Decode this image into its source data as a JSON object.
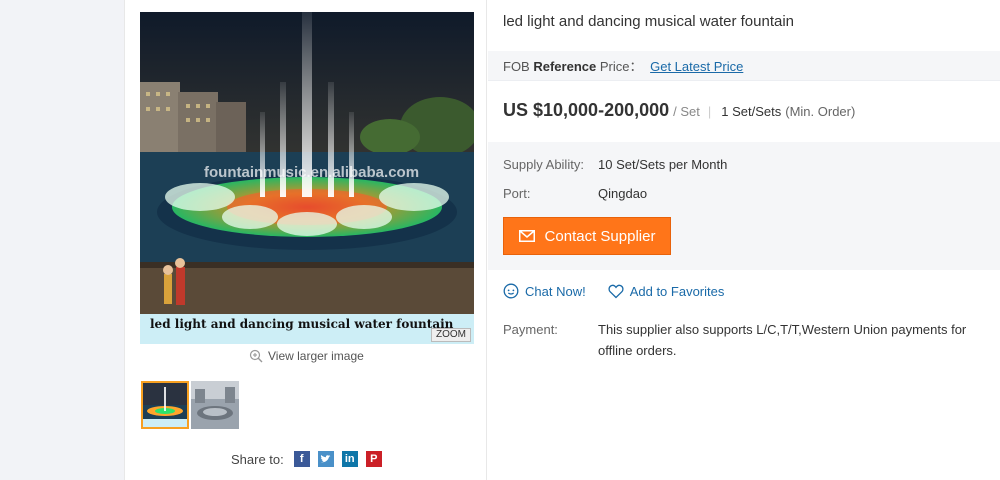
{
  "product": {
    "title": "led light and dancing musical water fountain",
    "image_caption": "led light and dancing musical water fountain",
    "watermark": "fountainmusic.en.alibaba.com",
    "zoom_label": "ZOOM",
    "view_larger": "View larger image",
    "share_label": "Share to:",
    "share_icons": [
      "facebook-icon",
      "twitter-icon",
      "linkedin-icon",
      "pinterest-icon"
    ]
  },
  "pricing": {
    "fob_prefix": "FOB",
    "fob_bold": "Reference",
    "fob_suffix": "Price：",
    "fob_link": "Get Latest Price",
    "price": "US $10,000-200,000",
    "price_unit": "/ Set",
    "separator": "|",
    "moq": "1 Set/Sets",
    "moq_note": "(Min. Order)"
  },
  "specs": {
    "supply_label": "Supply Ability:",
    "supply_value": "10 Set/Sets per Month",
    "port_label": "Port:",
    "port_value": "Qingdao"
  },
  "actions": {
    "contact": "Contact Supplier",
    "chat": "Chat Now!",
    "favorite": "Add to Favorites"
  },
  "payment": {
    "label": "Payment:",
    "text": "This supplier also supports L/C,T/T,Western Union payments for offline orders."
  },
  "colors": {
    "accent": "#ff7519",
    "link": "#1a6aa8",
    "thumb_active": "#f7a021"
  }
}
